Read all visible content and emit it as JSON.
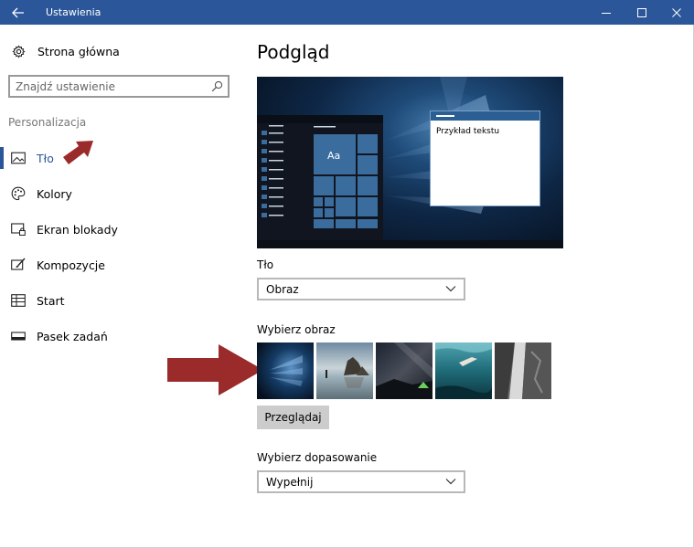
{
  "window": {
    "title": "Ustawienia",
    "accent": "#2b579a"
  },
  "sidebar": {
    "home_label": "Strona główna",
    "home_icon": "gear-icon",
    "search_placeholder": "Znajdź ustawienie",
    "section_heading": "Personalizacja",
    "items": [
      {
        "label": "Tło",
        "icon": "picture-icon",
        "active": true
      },
      {
        "label": "Kolory",
        "icon": "palette-icon",
        "active": false
      },
      {
        "label": "Ekran blokady",
        "icon": "lock-screen-icon",
        "active": false
      },
      {
        "label": "Kompozycje",
        "icon": "brush-icon",
        "active": false
      },
      {
        "label": "Start",
        "icon": "start-tiles-icon",
        "active": false
      },
      {
        "label": "Pasek zadań",
        "icon": "taskbar-icon",
        "active": false
      }
    ]
  },
  "main": {
    "title": "Podgląd",
    "preview": {
      "tile_label": "Aa",
      "sample_text": "Przykład tekstu"
    },
    "background": {
      "label": "Tło",
      "value": "Obraz"
    },
    "choose_image": {
      "label": "Wybierz obraz",
      "thumbnails": [
        "windows-light-image",
        "beach-rocks-image",
        "night-sky-tent-image",
        "underwater-swimmer-image",
        "rock-waterfall-image"
      ],
      "browse_label": "Przeglądaj"
    },
    "fit": {
      "label": "Wybierz dopasowanie",
      "value": "Wypełnij"
    }
  },
  "annotations": {
    "arrow_color": "#9b2b2b"
  }
}
